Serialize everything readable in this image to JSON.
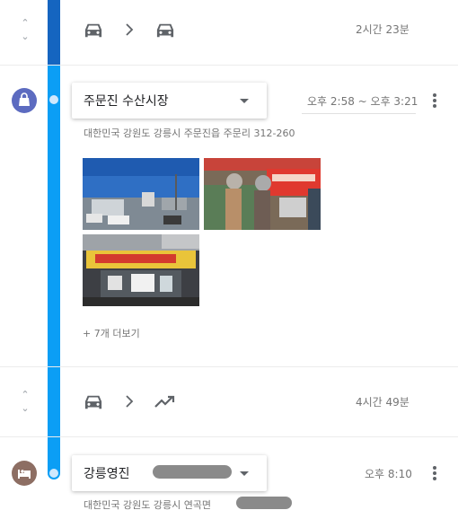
{
  "segment1": {
    "duration": "2시간 23분"
  },
  "place1": {
    "name": "주문진 수산시장",
    "time": "오후 2:58 ~ 오후 3:21",
    "address": "대한민국 강원도 강릉시 주문진읍 주문리 312-260",
    "more_photos": "+ 7개 더보기"
  },
  "segment2": {
    "duration": "4시간 49분"
  },
  "place2": {
    "name": "강릉영진",
    "time": "오후 8:10",
    "address": "대한민국 강원도 강릉시 연곡면"
  },
  "colors": {
    "line_dark": "#1565c0",
    "line_light": "#0b9ef5",
    "shopping": "#5c6bc0",
    "hotel": "#8d6e63"
  }
}
